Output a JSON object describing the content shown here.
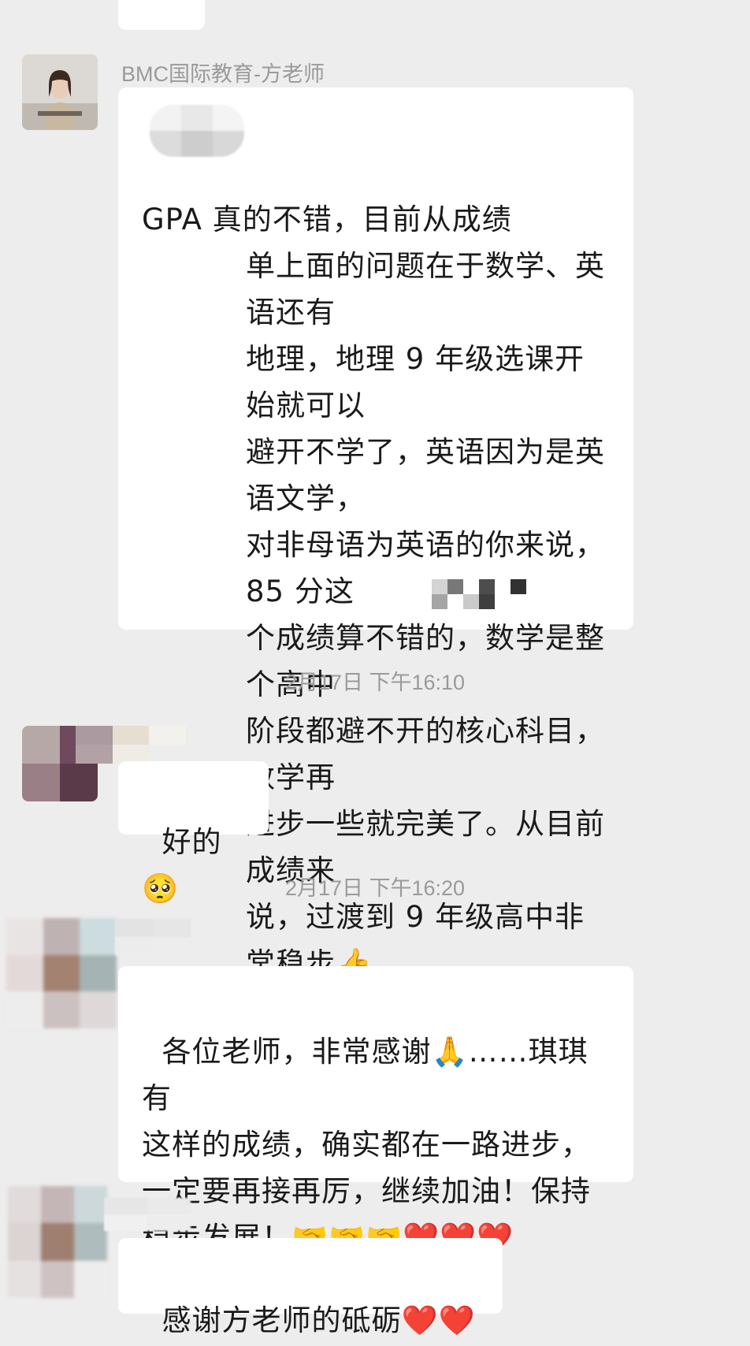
{
  "messages": [
    {
      "sender": "BMC国际教育-方老师",
      "text": "GPA 真的不错，目前从成绩\n单上面的问题在于数学、英语还有\n地理，地理 9 年级选课开始就可以\n避开不学了，英语因为是英语文学，\n对非母语为英语的你来说，85 分这\n个成绩算不错的，数学是整个高中\n阶段都避不开的核心科目，数学再\n进步一些就完美了。从目前成绩来\n说，过渡到 9 年级高中非常稳步👍\n不过不能泄气哈，要坚持，漫漫长\n路才刚开始呢，加油      🌞"
    },
    {
      "timestamp": "2月17日 下午16:10",
      "text": "好的🥺"
    },
    {
      "timestamp": "2月17日 下午16:20",
      "text": "各位老师，非常感谢🙏……琪琪有\n这样的成绩，确实都在一路进步，\n一定要再接再厉，继续加油！保持\n稳步发展！🤝🤝🤝❤️❤️❤️"
    },
    {
      "text": "感谢方老师的砥砺❤️❤️"
    }
  ],
  "icons": {
    "prev_emoji": "😮",
    "thumbs": "👍",
    "sun": "🌞",
    "pleading": "🥺",
    "pray": "🙏",
    "handshake": "🤝",
    "heart": "❤️"
  }
}
